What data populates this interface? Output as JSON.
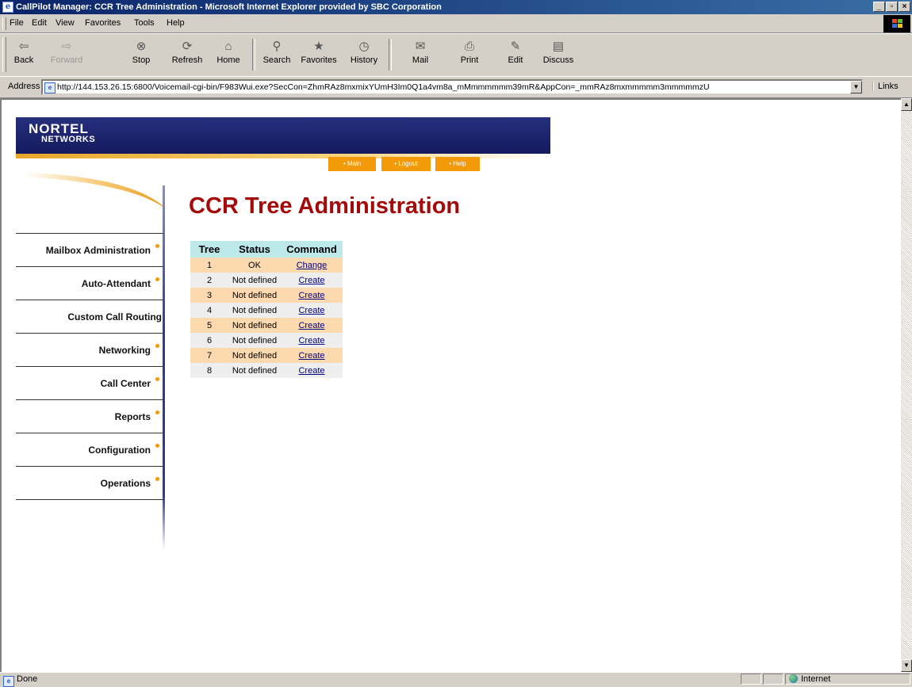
{
  "window": {
    "title": "CallPilot Manager: CCR Tree Administration - Microsoft Internet Explorer provided by SBC Corporation"
  },
  "menu": [
    "File",
    "Edit",
    "View",
    "Favorites",
    "Tools",
    "Help"
  ],
  "toolbar": {
    "back": "Back",
    "forward": "Forward",
    "stop": "Stop",
    "refresh": "Refresh",
    "home": "Home",
    "search": "Search",
    "favorites": "Favorites",
    "history": "History",
    "mail": "Mail",
    "print": "Print",
    "edit": "Edit",
    "discuss": "Discuss"
  },
  "address": {
    "label": "Address",
    "url": "http://144.153.26.15:6800/Voicemail-cgi-bin/F983Wui.exe?SecCon=ZhmRAz8mxmixYUmH3Im0Q1a4vm8a_mMmmmmmm39mR&AppCon=_mmRAz8mxmmmmm3mmmmmzU",
    "links": "Links"
  },
  "logo": {
    "line1": "NORTEL",
    "line2": "NETWORKS"
  },
  "topnav": [
    "• Main",
    "• Logout",
    "• Help"
  ],
  "page": {
    "title": "CCR Tree Administration"
  },
  "sidenav": [
    {
      "label": "Mailbox Administration",
      "dot": true
    },
    {
      "label": "Auto-Attendant",
      "dot": true
    },
    {
      "label": "Custom Call Routing",
      "dot": false
    },
    {
      "label": "Networking",
      "dot": true
    },
    {
      "label": "Call Center",
      "dot": true
    },
    {
      "label": "Reports",
      "dot": true
    },
    {
      "label": "Configuration",
      "dot": true
    },
    {
      "label": "Operations",
      "dot": true
    }
  ],
  "table": {
    "headers": [
      "Tree",
      "Status",
      "Command"
    ],
    "rows": [
      {
        "tree": "1",
        "status": "OK",
        "command": "Change"
      },
      {
        "tree": "2",
        "status": "Not defined",
        "command": "Create"
      },
      {
        "tree": "3",
        "status": "Not defined",
        "command": "Create"
      },
      {
        "tree": "4",
        "status": "Not defined",
        "command": "Create"
      },
      {
        "tree": "5",
        "status": "Not defined",
        "command": "Create"
      },
      {
        "tree": "6",
        "status": "Not defined",
        "command": "Create"
      },
      {
        "tree": "7",
        "status": "Not defined",
        "command": "Create"
      },
      {
        "tree": "8",
        "status": "Not defined",
        "command": "Create"
      }
    ]
  },
  "status": {
    "text": "Done",
    "zone": "Internet"
  },
  "colors": {
    "title_red": "#a40a0a",
    "nav_orange": "#f29a0a",
    "banner_blue": "#1c237a",
    "row_orange": "#fdd9b0",
    "row_gray": "#eeeeee",
    "header_cyan": "#bde8ea"
  }
}
